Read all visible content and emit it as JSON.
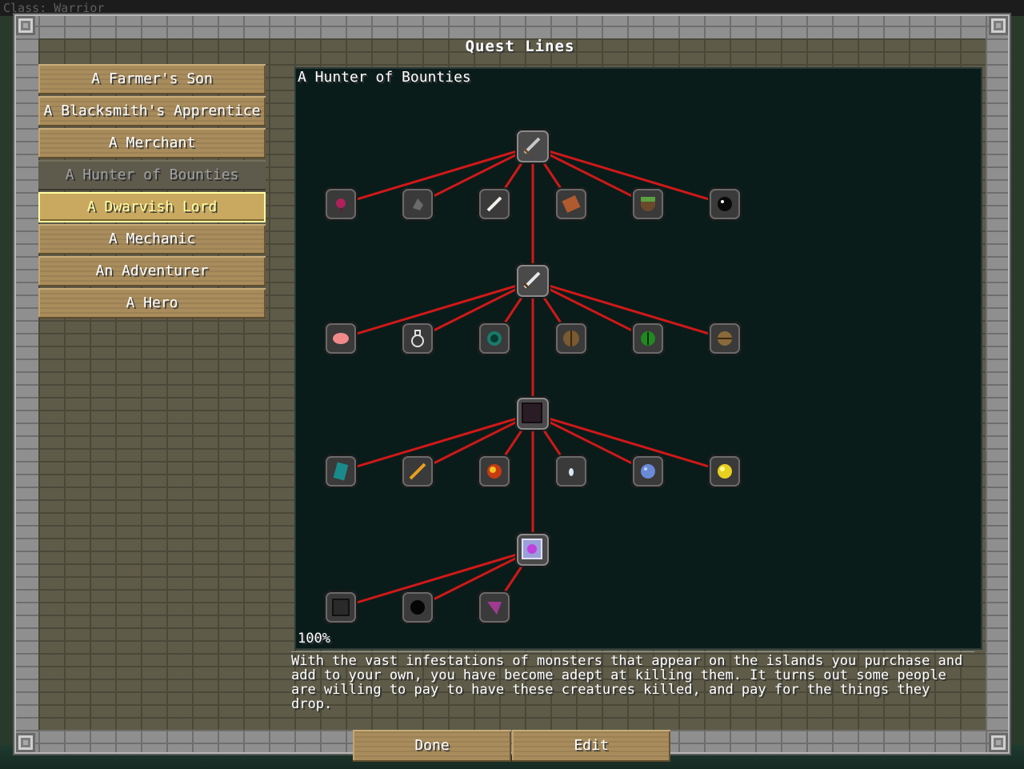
{
  "background": {
    "class_label": "Class: Warrior"
  },
  "window": {
    "title": "Quest Lines"
  },
  "quest_lines": [
    {
      "label": "A Farmer's Son",
      "state": "normal"
    },
    {
      "label": "A Blacksmith's Apprentice",
      "state": "normal"
    },
    {
      "label": "A Merchant",
      "state": "normal"
    },
    {
      "label": "A Hunter of Bounties",
      "state": "selected"
    },
    {
      "label": "A Dwarvish Lord",
      "state": "hover"
    },
    {
      "label": "A Mechanic",
      "state": "normal"
    },
    {
      "label": "An Adventurer",
      "state": "normal"
    },
    {
      "label": "A Hero",
      "state": "normal"
    }
  ],
  "tree": {
    "title": "A Hunter of Bounties",
    "zoom": "100%",
    "tiers": [
      {
        "main_icon": "iron-sword-icon",
        "children": [
          "red-dye-icon",
          "flint-icon",
          "bone-icon",
          "leather-icon",
          "slimeball-grass-icon",
          "ender-pearl-black-icon"
        ]
      },
      {
        "main_icon": "diamond-sword-icon",
        "children": [
          "raw-pork-icon",
          "glass-bottle-icon",
          "ender-pearl-icon",
          "wood-shield-icon",
          "slime-eye-icon",
          "wood-ball-icon"
        ]
      },
      {
        "main_icon": "obsidian-block-icon",
        "children": [
          "music-disc-icon",
          "blaze-rod-icon",
          "fire-charge-icon",
          "ghast-tear-icon",
          "snowball-icon",
          "gold-nugget-icon"
        ]
      },
      {
        "main_icon": "nether-star-block-icon",
        "children": [
          "coal-block-icon",
          "coal-icon",
          "shulker-shell-icon"
        ]
      }
    ]
  },
  "description": "With the vast infestations of monsters that appear on the islands you purchase and add to your own, you have become adept at killing them. It turns out some people are willing to pay to have these creatures killed, and pay for the things they drop.",
  "buttons": {
    "done_label": "Done",
    "edit_label": "Edit"
  },
  "colors": {
    "connector": "#d01818",
    "panel": "#0a1c1a",
    "hover_text": "#ffffa0"
  }
}
